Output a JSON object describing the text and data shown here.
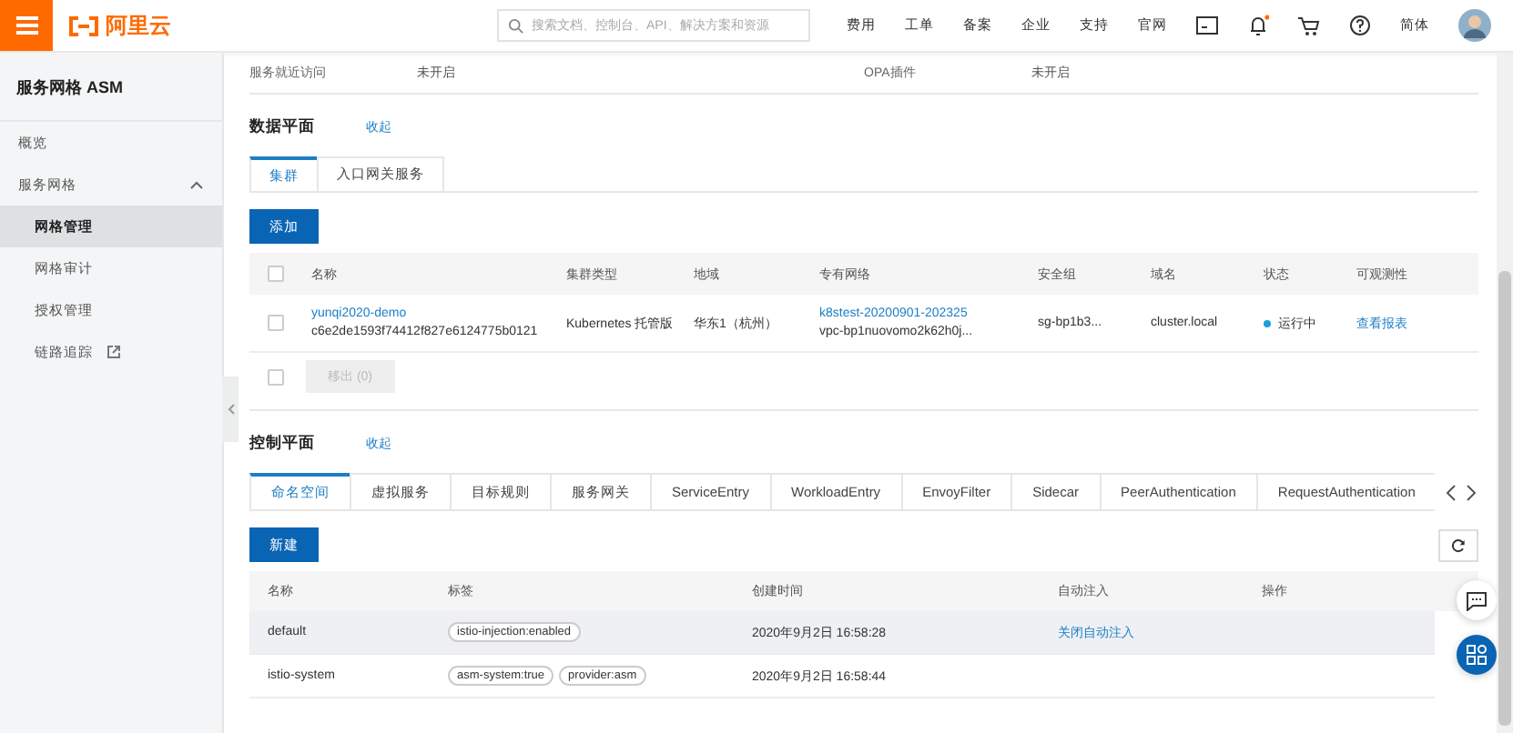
{
  "topbar": {
    "logo": "阿里云",
    "search": {
      "placeholder": "搜索文档、控制台、API、解决方案和资源"
    },
    "nav": [
      "费用",
      "工单",
      "备案",
      "企业",
      "支持",
      "官网"
    ],
    "language": "简体",
    "notification_dot": true
  },
  "sidebar": {
    "title": "服务网格 ASM",
    "items": [
      {
        "label": "概览",
        "selected": false,
        "external": false
      },
      {
        "label": "服务网格",
        "selected": false,
        "expanded": true,
        "external": false,
        "children": [
          {
            "label": "网格管理",
            "selected": true,
            "external": false
          },
          {
            "label": "网格审计",
            "selected": false,
            "external": false
          },
          {
            "label": "授权管理",
            "selected": false,
            "external": false
          },
          {
            "label": "链路追踪",
            "selected": false,
            "external": true
          }
        ]
      }
    ]
  },
  "info": [
    {
      "label": "服务就近访问",
      "value": "未开启"
    },
    {
      "label": "OPA插件",
      "value": "未开启"
    }
  ],
  "data_plane": {
    "title": "数据平面",
    "collapse": "收起",
    "tabs": [
      {
        "label": "集群",
        "selected": true
      },
      {
        "label": "入口网关服务",
        "selected": false
      }
    ],
    "add_button": "添加",
    "select_all_checked": false,
    "columns": [
      "名称",
      "集群类型",
      "地域",
      "专有网络",
      "安全组",
      "域名",
      "状态",
      "可观测性"
    ],
    "rows": [
      {
        "checked": false,
        "name": "yunqi2020-demo",
        "id": "c6e2de1593f74412f827e6124775b0121",
        "type": "Kubernetes 托管版",
        "region": "华东1（杭州）",
        "vpc": "k8stest-20200901-202325",
        "vpc_id": "vpc-bp1nuovomo2k62h0j...",
        "security_group": "sg-bp1b3...",
        "domain": "cluster.local",
        "status": "运行中",
        "color": "#1ba0d8",
        "observability": "查看报表"
      }
    ],
    "footer_checked": false,
    "remove_button": {
      "label": "移出 (0)",
      "disabled": true
    }
  },
  "control_plane": {
    "title": "控制平面",
    "collapse": "收起",
    "tabs": [
      {
        "label": "命名空间",
        "selected": true
      },
      {
        "label": "虚拟服务",
        "selected": false
      },
      {
        "label": "目标规则",
        "selected": false
      },
      {
        "label": "服务网关",
        "selected": false
      },
      {
        "label": "ServiceEntry",
        "selected": false
      },
      {
        "label": "WorkloadEntry",
        "selected": false
      },
      {
        "label": "EnvoyFilter",
        "selected": false
      },
      {
        "label": "Sidecar",
        "selected": false
      },
      {
        "label": "PeerAuthentication",
        "selected": false
      },
      {
        "label": "RequestAuthentication",
        "selected": false
      }
    ],
    "new_button": "新建",
    "columns": [
      "名称",
      "标签",
      "创建时间",
      "自动注入",
      "操作"
    ],
    "rows": [
      {
        "name": "default",
        "tags": [
          "istio-injection:enabled"
        ],
        "created": "2020年9月2日 16:58:28",
        "injection": "关闭自动注入",
        "hovered": true
      },
      {
        "name": "istio-system",
        "tags": [
          "asm-system:true",
          "provider:asm"
        ],
        "created": "2020年9月2日 16:58:44",
        "hovered": false
      }
    ]
  }
}
